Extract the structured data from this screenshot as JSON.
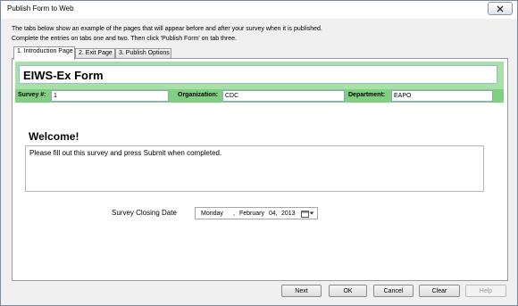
{
  "window": {
    "title": "Publish Form to Web"
  },
  "instructions": {
    "line1": "The tabs below show an example of the pages that will appear before and after your survey when it is published.",
    "line2": "Complete the entries on tabs one and two.  Then click 'Publish Form' on tab three."
  },
  "tabs": [
    {
      "label": "1. Introduction Page",
      "active": true
    },
    {
      "label": "2. Exit Page",
      "active": false
    },
    {
      "label": "3. Publish Options",
      "active": false
    }
  ],
  "form": {
    "title": "EIWS-Ex Form",
    "survey_label": "Survey #:",
    "survey_value": "1",
    "organization_label": "Organization:",
    "organization_value": "CDC",
    "department_label": "Department:",
    "department_value": "EAPO"
  },
  "welcome": {
    "heading": "Welcome!",
    "message": "Please fill out this survey and press Submit when completed."
  },
  "closing_date": {
    "label": "Survey Closing Date",
    "weekday": "Monday",
    "separator": ",",
    "month": "February",
    "day": "04,",
    "year": "2013"
  },
  "buttons": {
    "next": "Next",
    "ok": "OK",
    "cancel": "Cancel",
    "clear": "Clear",
    "help": "Help"
  },
  "colors": {
    "header_bar": "#a8e1a8",
    "field_row": "#81cf81"
  }
}
